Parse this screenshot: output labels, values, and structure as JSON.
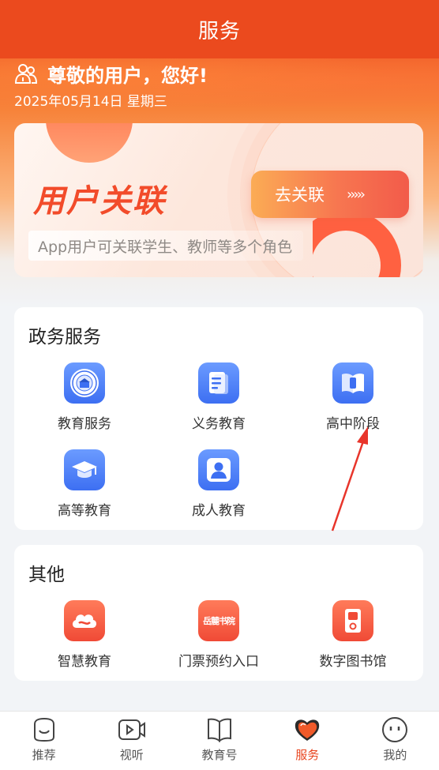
{
  "header": {
    "title": "服务"
  },
  "greeting": {
    "text": "尊敬的用户，您好!",
    "date": "2025年05月14日 星期三"
  },
  "banner": {
    "title": "用户关联",
    "button_label": "去关联",
    "button_arrows": "›››››",
    "subtitle": "App用户可关联学生、教师等多个角色"
  },
  "gov_services": {
    "title": "政务服务",
    "items": [
      {
        "label": "教育服务",
        "icon": "emblem-icon"
      },
      {
        "label": "义务教育",
        "icon": "document-icon"
      },
      {
        "label": "高中阶段",
        "icon": "book-icon"
      },
      {
        "label": "高等教育",
        "icon": "graduation-cap-icon"
      },
      {
        "label": "成人教育",
        "icon": "person-icon"
      }
    ]
  },
  "others": {
    "title": "其他",
    "items": [
      {
        "label": "智慧教育",
        "icon": "cloud-icon"
      },
      {
        "label": "门票预约入口",
        "icon": "academy-logo-icon",
        "logo_text": "岳麓书院"
      },
      {
        "label": "数字图书馆",
        "icon": "library-icon"
      }
    ]
  },
  "tabbar": {
    "tabs": [
      {
        "label": "推荐",
        "icon": "smile-icon",
        "active": false
      },
      {
        "label": "视听",
        "icon": "video-icon",
        "active": false
      },
      {
        "label": "教育号",
        "icon": "book-open-icon",
        "active": false
      },
      {
        "label": "服务",
        "icon": "heart-icon",
        "active": true
      },
      {
        "label": "我的",
        "icon": "face-icon",
        "active": false
      }
    ]
  },
  "colors": {
    "brand": "#eb4a1e",
    "blue_icon": "#3d6ff2",
    "red_icon": "#f04a36",
    "annotation_arrow": "#e8352b"
  }
}
